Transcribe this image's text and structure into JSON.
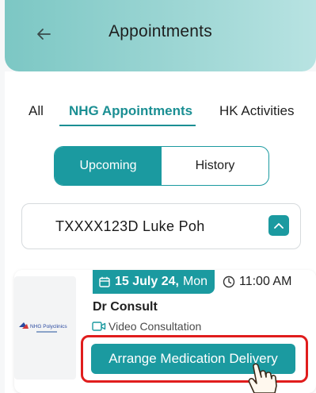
{
  "header": {
    "title": "Appointments",
    "back_icon": "arrow-left-icon"
  },
  "tabs": [
    {
      "label": "All",
      "active": false
    },
    {
      "label": "NHG Appointments",
      "active": true
    },
    {
      "label": "HK Activities",
      "active": false
    }
  ],
  "segment": {
    "upcoming_label": "Upcoming",
    "history_label": "History",
    "selected": "Upcoming"
  },
  "patient": {
    "name": "TXXXX123D Luke Poh",
    "dropdown_icon": "chevron-up-icon"
  },
  "appointment": {
    "calendar_icon": "calendar-icon",
    "date": "15 July 24,",
    "day": "Mon",
    "time_icon": "clock-icon",
    "time": "11:00 AM",
    "doctor": "Dr Consult",
    "type_icon": "video-icon",
    "type": "Video Consultation",
    "logo_text": "NHG Polyclinics",
    "cta_label": "Arrange Medication Delivery"
  },
  "colors": {
    "accent": "#1b9aa0",
    "header_gradient_start": "#7cc7c4",
    "highlight": "#e01d1d"
  }
}
